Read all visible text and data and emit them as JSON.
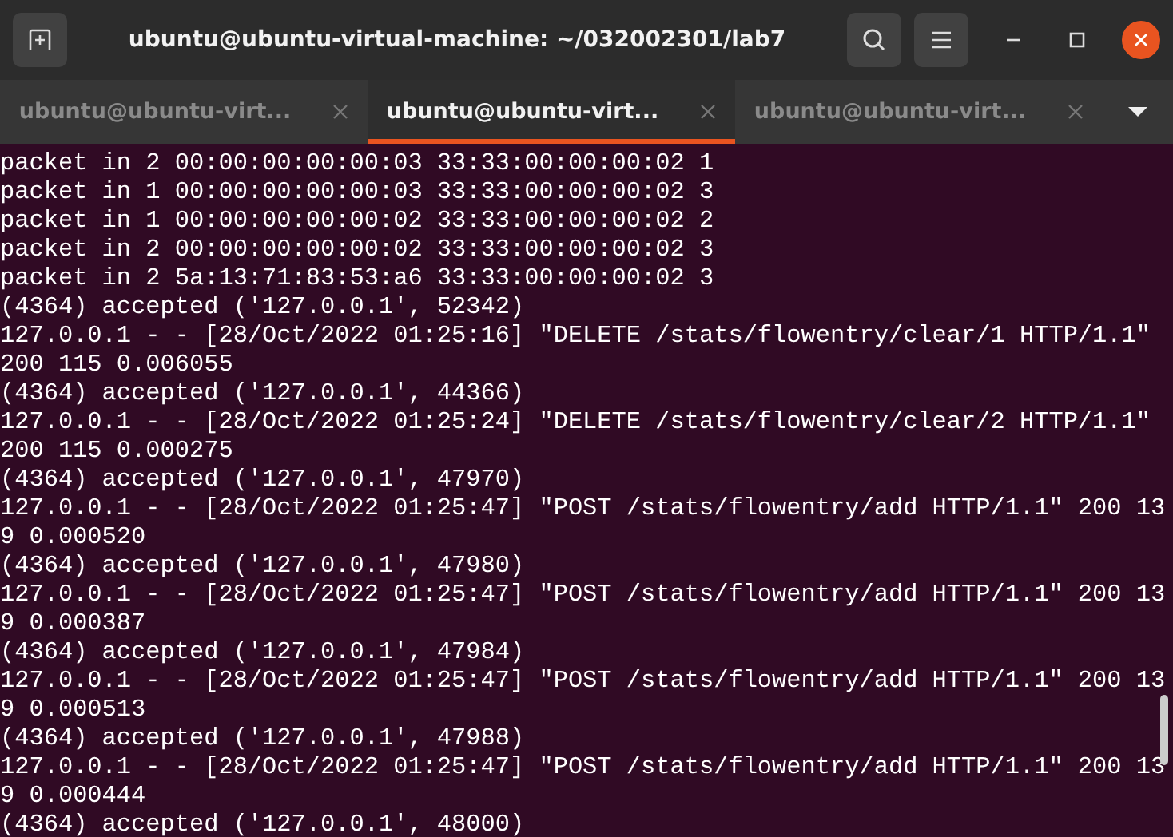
{
  "window": {
    "title": "ubuntu@ubuntu-virtual-machine: ~/032002301/lab7"
  },
  "tabs": [
    {
      "label": "ubuntu@ubuntu-virt...",
      "selected": false
    },
    {
      "label": "ubuntu@ubuntu-virt...",
      "selected": true
    },
    {
      "label": "ubuntu@ubuntu-virt...",
      "selected": false
    }
  ],
  "terminal": {
    "lines": [
      "packet in 2 00:00:00:00:00:03 33:33:00:00:00:02 1",
      "packet in 1 00:00:00:00:00:03 33:33:00:00:00:02 3",
      "packet in 1 00:00:00:00:00:02 33:33:00:00:00:02 2",
      "packet in 2 00:00:00:00:00:02 33:33:00:00:00:02 3",
      "packet in 2 5a:13:71:83:53:a6 33:33:00:00:00:02 3",
      "(4364) accepted ('127.0.0.1', 52342)",
      "127.0.0.1 - - [28/Oct/2022 01:25:16] \"DELETE /stats/flowentry/clear/1 HTTP/1.1\"",
      "200 115 0.006055",
      "(4364) accepted ('127.0.0.1', 44366)",
      "127.0.0.1 - - [28/Oct/2022 01:25:24] \"DELETE /stats/flowentry/clear/2 HTTP/1.1\"",
      "200 115 0.000275",
      "(4364) accepted ('127.0.0.1', 47970)",
      "127.0.0.1 - - [28/Oct/2022 01:25:47] \"POST /stats/flowentry/add HTTP/1.1\" 200 13",
      "9 0.000520",
      "(4364) accepted ('127.0.0.1', 47980)",
      "127.0.0.1 - - [28/Oct/2022 01:25:47] \"POST /stats/flowentry/add HTTP/1.1\" 200 13",
      "9 0.000387",
      "(4364) accepted ('127.0.0.1', 47984)",
      "127.0.0.1 - - [28/Oct/2022 01:25:47] \"POST /stats/flowentry/add HTTP/1.1\" 200 13",
      "9 0.000513",
      "(4364) accepted ('127.0.0.1', 47988)",
      "127.0.0.1 - - [28/Oct/2022 01:25:47] \"POST /stats/flowentry/add HTTP/1.1\" 200 13",
      "9 0.000444",
      "(4364) accepted ('127.0.0.1', 48000)"
    ]
  }
}
